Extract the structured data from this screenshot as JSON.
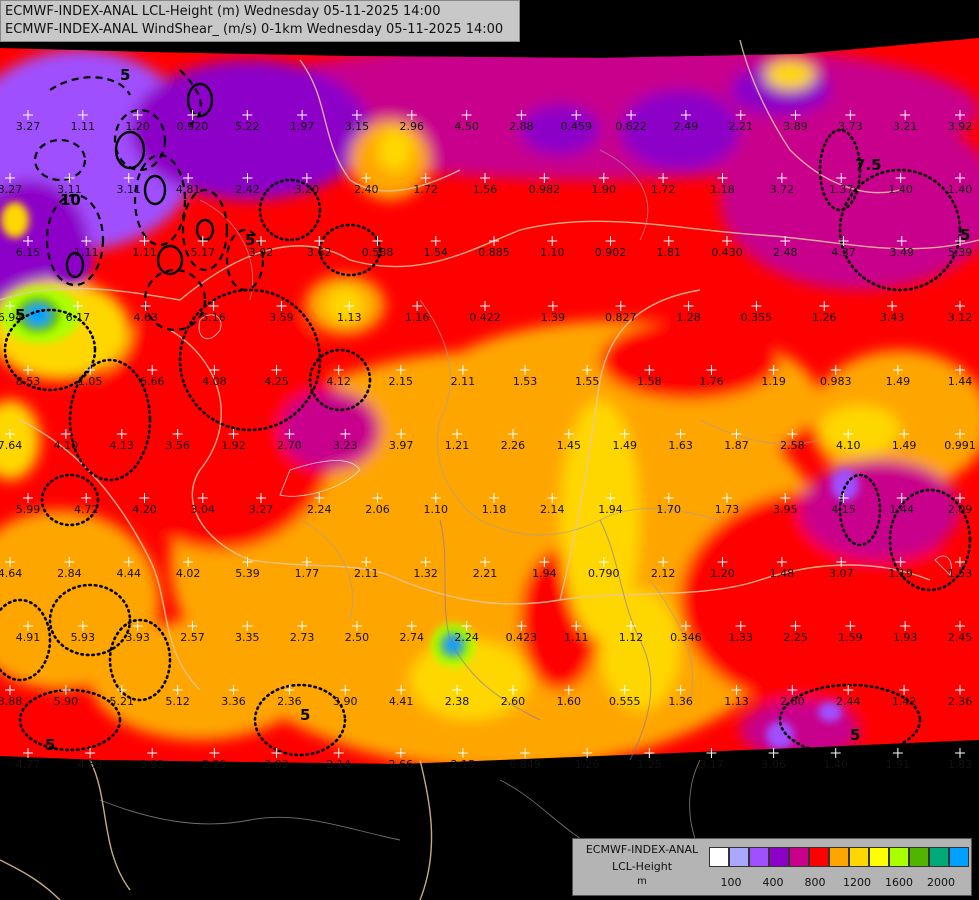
{
  "header": {
    "line1": "ECMWF-INDEX-ANAL LCL-Height (m) Wednesday 05-11-2025 14:00",
    "line2": "ECMWF-INDEX-ANAL WindShear_ (m/s) 0-1km Wednesday 05-11-2025 14:00"
  },
  "legend": {
    "title_line1": "ECMWF-INDEX-ANAL",
    "title_line2": "LCL-Height",
    "unit": "m",
    "colors": [
      "#ffffff",
      "#aaa7ff",
      "#a050ff",
      "#8c00c8",
      "#c8008c",
      "#ff0000",
      "#ffa500",
      "#ffd700",
      "#ffff00",
      "#aaff00",
      "#50b400",
      "#00aa78",
      "#00a0ff"
    ],
    "ticks": [
      "100",
      "400",
      "800",
      "1200",
      "1600",
      "2000"
    ]
  },
  "contour_labels": [
    "5",
    "7.5",
    "10",
    "5",
    "5",
    "5",
    "5",
    "5",
    "5"
  ],
  "values": [
    [
      "3.27",
      "1.11",
      "1.20",
      "0.920",
      "5.22",
      "1.97",
      "3.15",
      "2.96",
      "4.50",
      "2.88",
      "0.459",
      "0.622",
      "2.49",
      "2.21",
      "3.89",
      "3.73",
      "3.21",
      "3.92"
    ],
    [
      "3.27",
      "3.11",
      "3.11",
      "4.81",
      "2.42",
      "3.20",
      "2.40",
      "1.72",
      "1.56",
      "0.982",
      "1.90",
      "1.72",
      "1.18",
      "3.72",
      "1.37",
      "1.40",
      "1.40"
    ],
    [
      "6.15",
      "1.11",
      "1.11",
      "5.17",
      "3.92",
      "3.62",
      "0.588",
      "1.54",
      "0.885",
      "1.10",
      "0.902",
      "1.81",
      "0.430",
      "2.48",
      "4.37",
      "3.49",
      "5.39"
    ],
    [
      "6.94",
      "6.17",
      "4.63",
      "5.16",
      "3.59",
      "1.13",
      "1.16",
      "0.422",
      "1.39",
      "0.827",
      "1.28",
      "0.355",
      "1.26",
      "3.43",
      "3.12"
    ],
    [
      "8.53",
      "1.05",
      "6.66",
      "4.08",
      "4.25",
      "4.12",
      "2.15",
      "2.11",
      "1.53",
      "1.55",
      "1.58",
      "1.76",
      "1.19",
      "0.983",
      "1.49",
      "1.44"
    ],
    [
      "7.64",
      "4.10",
      "4.13",
      "3.56",
      "1.92",
      "2.70",
      "3.23",
      "3.97",
      "1.21",
      "2.26",
      "1.45",
      "1.49",
      "1.63",
      "1.87",
      "2.58",
      "4.10",
      "1.49",
      "0.991"
    ],
    [
      "5.99",
      "4.72",
      "4.20",
      "3.04",
      "3.27",
      "2.24",
      "2.06",
      "1.10",
      "1.18",
      "2.14",
      "1.94",
      "1.70",
      "1.73",
      "3.95",
      "4.15",
      "1.44",
      "2.09"
    ],
    [
      "4.64",
      "2.84",
      "4.44",
      "4.02",
      "5.39",
      "1.77",
      "2.11",
      "1.32",
      "2.21",
      "1.94",
      "0.790",
      "2.12",
      "1.20",
      "1.48",
      "3.07",
      "1.19",
      "1.53"
    ],
    [
      "4.91",
      "5.93",
      "3.93",
      "2.57",
      "3.35",
      "2.73",
      "2.50",
      "2.74",
      "2.24",
      "0.423",
      "1.11",
      "1.12",
      "0.346",
      "1.33",
      "2.25",
      "1.59",
      "1.93",
      "2.45"
    ],
    [
      "3.88",
      "5.90",
      "5.21",
      "5.12",
      "3.36",
      "2.36",
      "3.90",
      "4.41",
      "2.38",
      "2.60",
      "1.60",
      "0.555",
      "1.36",
      "1.13",
      "2.80",
      "2.44",
      "1.42",
      "2.36"
    ],
    [
      "4.77",
      "4.83",
      "3.93",
      "2.25",
      "3.92",
      "2.14",
      "2.66",
      "2.15",
      "0.849",
      "1.26",
      "1.25",
      "3.17",
      "3.06",
      "1.40",
      "1.91",
      "1.83"
    ]
  ]
}
